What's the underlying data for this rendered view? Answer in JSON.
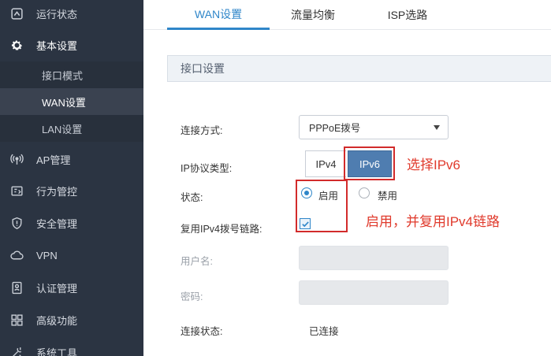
{
  "sidebar": {
    "items": [
      {
        "label": "运行状态",
        "icon": "gauge-icon"
      },
      {
        "label": "基本设置",
        "icon": "gear-icon"
      },
      {
        "label": "AP管理",
        "icon": "ap-antenna-icon"
      },
      {
        "label": "行为管控",
        "icon": "behavior-control-icon"
      },
      {
        "label": "安全管理",
        "icon": "shield-icon"
      },
      {
        "label": "VPN",
        "icon": "vpn-cloud-icon"
      },
      {
        "label": "认证管理",
        "icon": "auth-badge-icon"
      },
      {
        "label": "高级功能",
        "icon": "grid-icon"
      },
      {
        "label": "系统工具",
        "icon": "tools-icon"
      }
    ],
    "sub_items": [
      {
        "label": "接口模式"
      },
      {
        "label": "WAN设置"
      },
      {
        "label": "LAN设置"
      }
    ]
  },
  "tabs": [
    {
      "label": "WAN设置"
    },
    {
      "label": "流量均衡"
    },
    {
      "label": "ISP选路"
    }
  ],
  "section": {
    "title": "接口设置"
  },
  "form": {
    "conn_type_label": "连接方式:",
    "conn_type_value": "PPPoE拨号",
    "ip_proto_label": "IP协议类型:",
    "ipv4_label": "IPv4",
    "ipv6_label": "IPv6",
    "status_label": "状态:",
    "enable_label": "启用",
    "disable_label": "禁用",
    "reuse_label": "复用IPv4拨号链路:",
    "username_label": "用户名:",
    "password_label": "密码:",
    "conn_status_label": "连接状态:",
    "conn_status_value": "已连接"
  },
  "annotations": {
    "select_ipv6": "选择IPv6",
    "enable_reuse": "启用，并复用IPv4链路"
  },
  "colors": {
    "sidebar_bg": "#2b3442",
    "accent": "#2f86c9",
    "ipv6_button": "#4f7db0",
    "annotation_red": "#e03a2c"
  }
}
